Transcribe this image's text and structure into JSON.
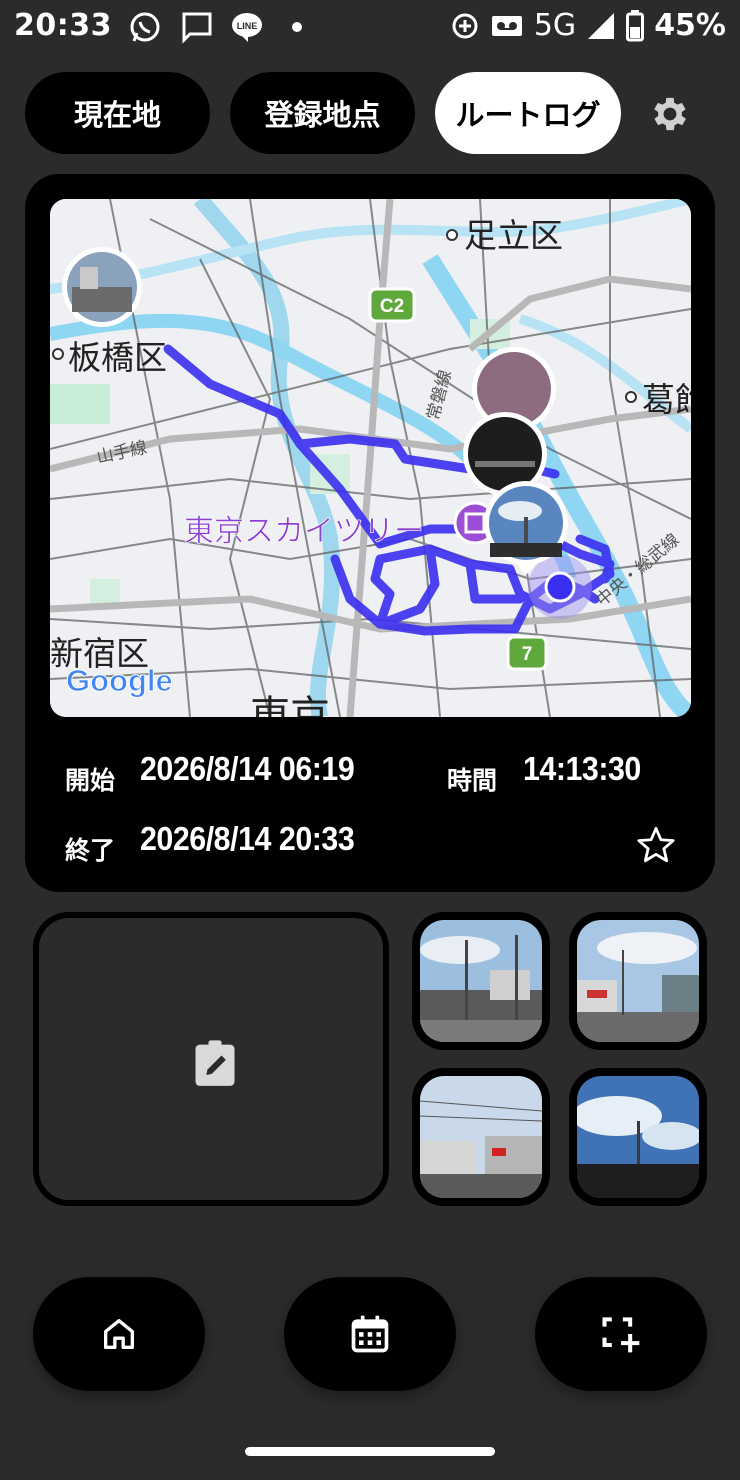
{
  "status_bar": {
    "time": "20:33",
    "network": "5G",
    "battery": "45%",
    "icons": [
      "whatsapp-icon",
      "message-icon",
      "line-icon",
      "dot-icon",
      "data-saver-icon",
      "voicemail-icon",
      "signal-icon",
      "battery-icon"
    ]
  },
  "tabs": {
    "current_location": "現在地",
    "registered_points": "登録地点",
    "route_log": "ルートログ"
  },
  "map": {
    "labels": {
      "adachi": "足立区",
      "itabashi": "板橋区",
      "katsushika": "葛飾",
      "yamanote": "山手線",
      "joban": "常磐線",
      "chuo_sobu": "中央・総武線",
      "skytree": "東京スカイツリー",
      "shinjuku": "新宿区",
      "tokyo": "東京",
      "c2": "C2",
      "route7": "7",
      "google": "Google"
    },
    "colors": {
      "route": "#3a2ff0",
      "water": "#8fd6f2",
      "poi": "#9c4fd6"
    }
  },
  "route": {
    "start_label": "開始",
    "start_value": "2026/8/14 06:19",
    "end_label": "終了",
    "end_value": "2026/8/14 20:33",
    "duration_label": "時間",
    "duration_value": "14:13:30"
  },
  "bottom_nav": [
    "home-icon",
    "calendar-icon",
    "add-photo-icon"
  ]
}
